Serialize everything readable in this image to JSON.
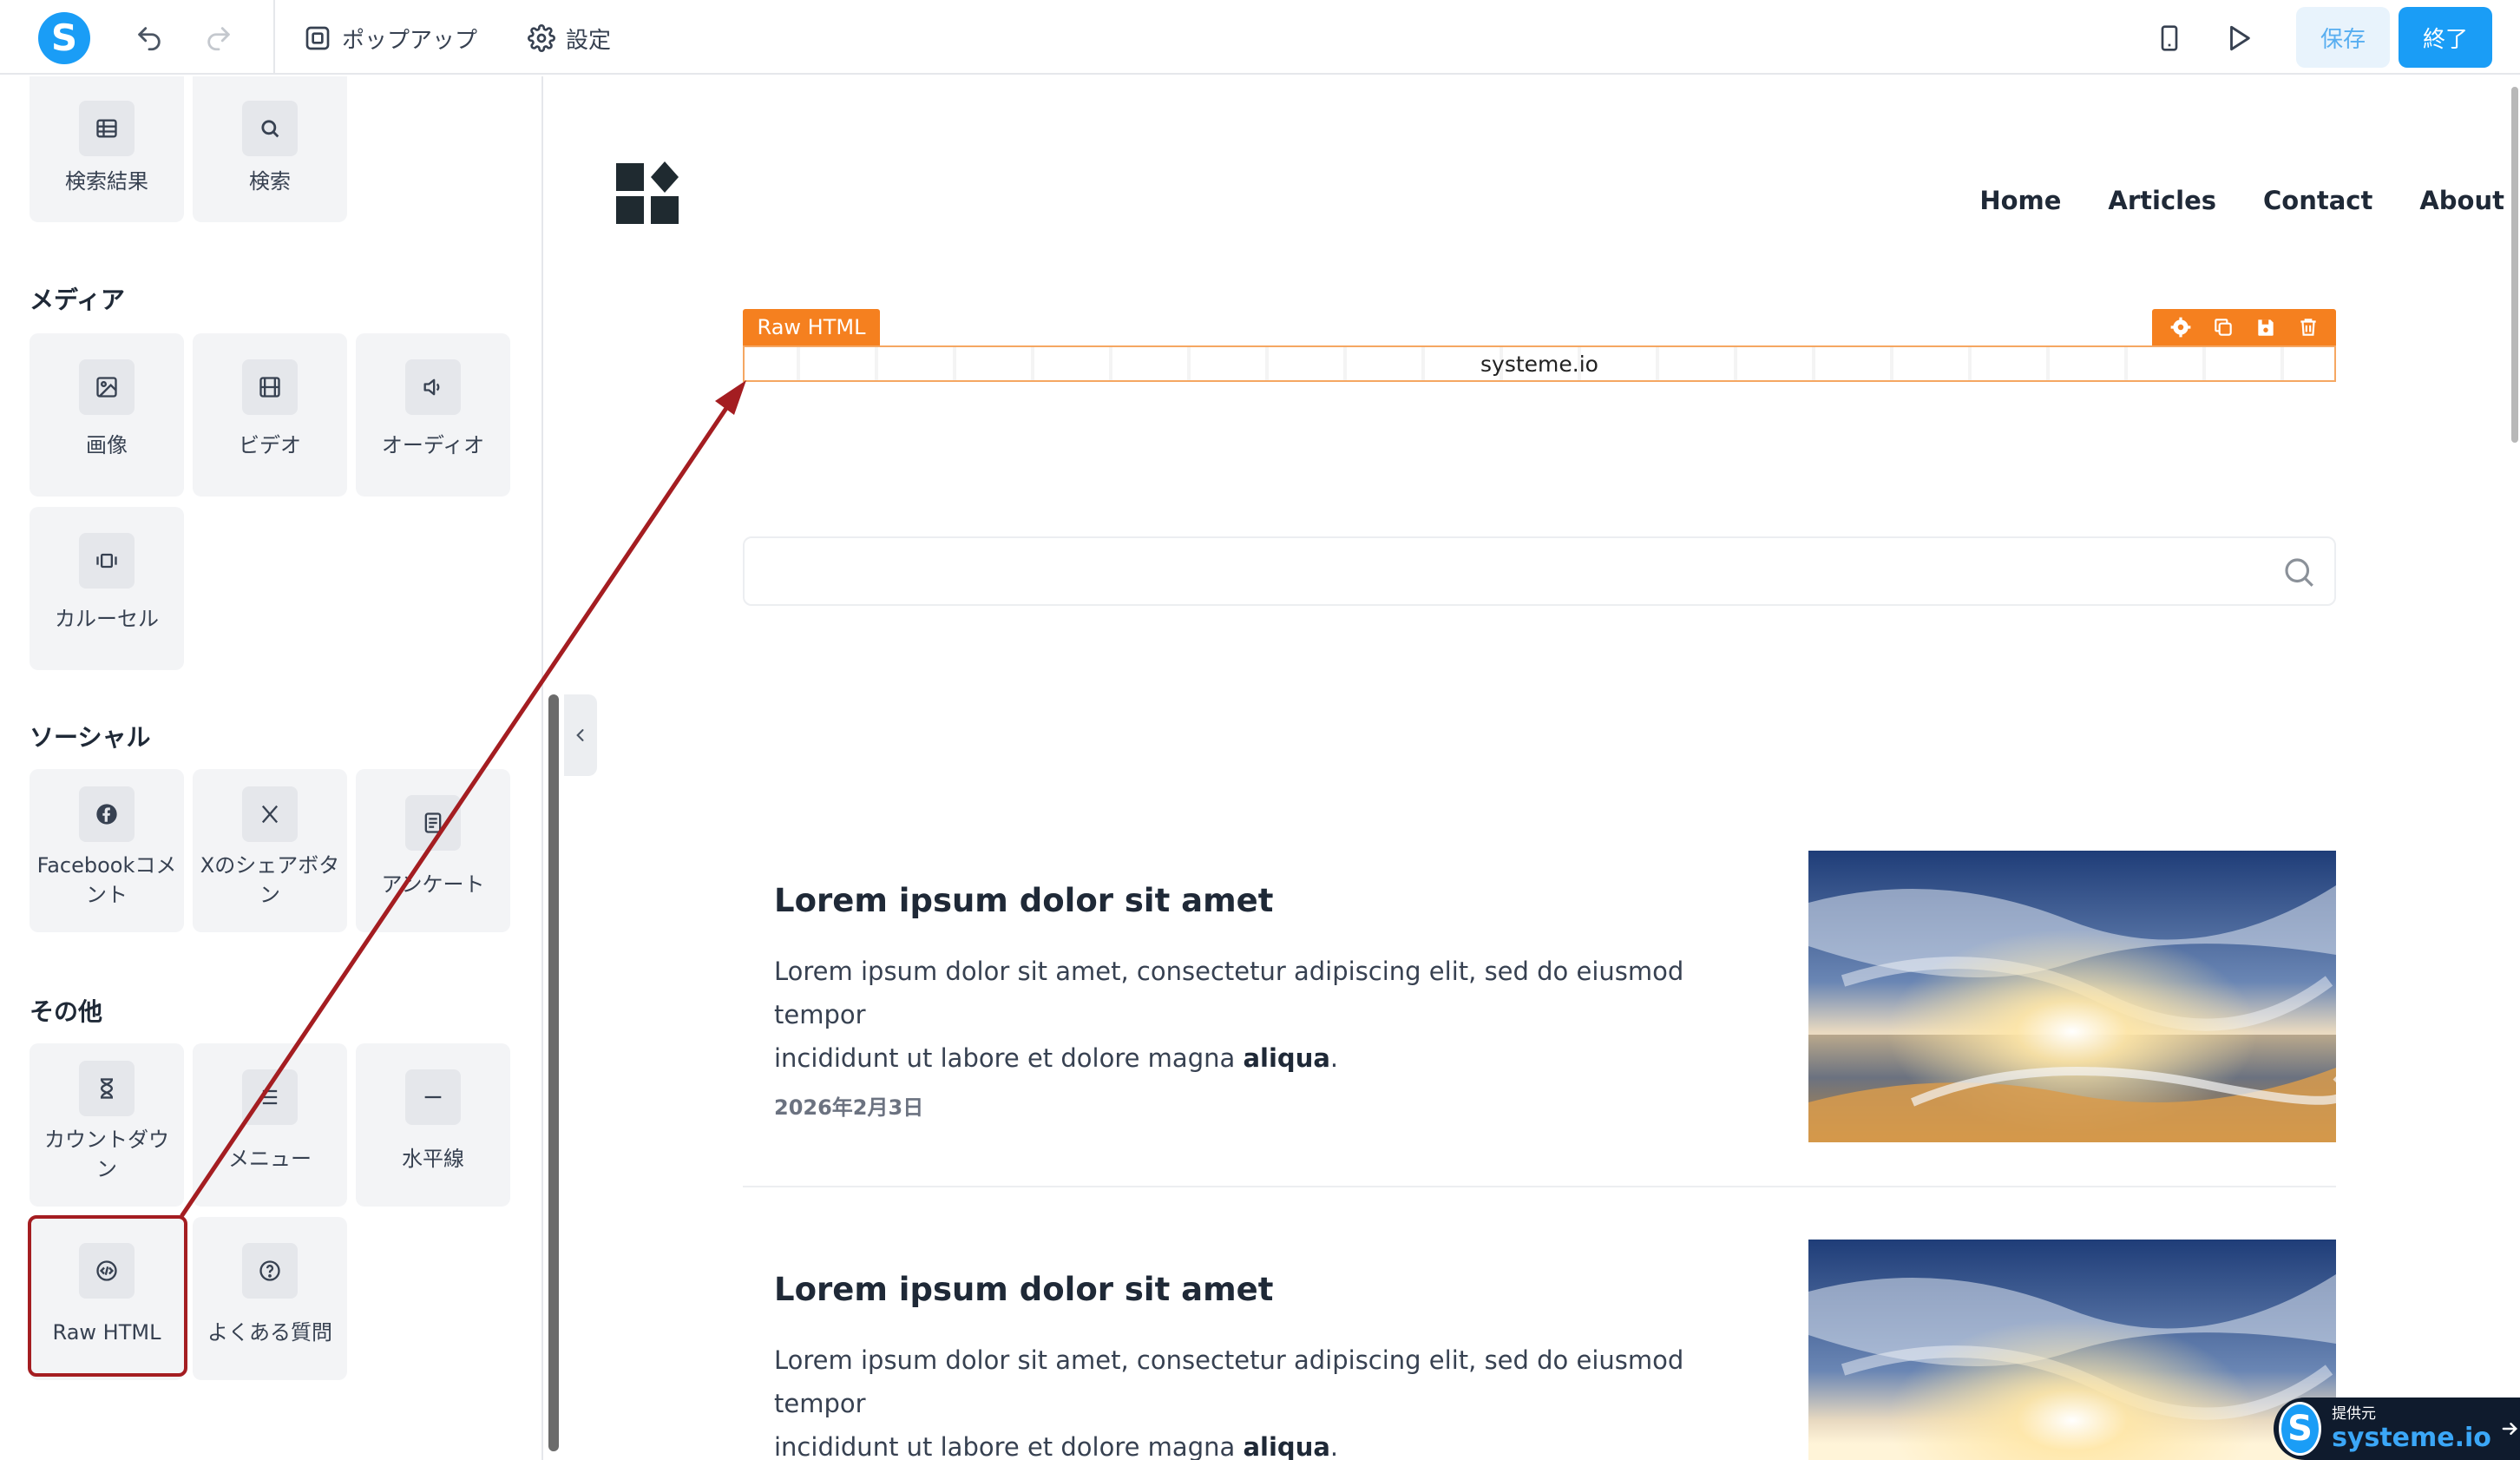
{
  "toolbar": {
    "logo_letter": "S",
    "popup_label": "ポップアップ",
    "settings_label": "設定",
    "save_label": "保存",
    "finish_label": "終了"
  },
  "sidebar": {
    "top_items": [
      {
        "label": "検索結果",
        "icon": "table-icon"
      },
      {
        "label": "検索",
        "icon": "search-icon"
      }
    ],
    "sections": {
      "media": {
        "title": "メディア",
        "items": [
          {
            "label": "画像",
            "icon": "image-icon"
          },
          {
            "label": "ビデオ",
            "icon": "video-icon"
          },
          {
            "label": "オーディオ",
            "icon": "audio-icon"
          },
          {
            "label": "カルーセル",
            "icon": "carousel-icon"
          }
        ]
      },
      "social": {
        "title": "ソーシャル",
        "items": [
          {
            "label": "Facebookコメント",
            "icon": "facebook-icon"
          },
          {
            "label": "Xのシェアボタン",
            "icon": "x-icon"
          },
          {
            "label": "アンケート",
            "icon": "survey-icon"
          }
        ]
      },
      "other": {
        "title": "その他",
        "items": [
          {
            "label": "カウントダウン",
            "icon": "hourglass-icon"
          },
          {
            "label": "メニュー",
            "icon": "menu-icon"
          },
          {
            "label": "水平線",
            "icon": "divider-icon"
          },
          {
            "label": "Raw HTML",
            "icon": "code-icon"
          },
          {
            "label": "よくある質問",
            "icon": "question-icon"
          }
        ]
      }
    }
  },
  "canvas": {
    "nav": [
      "Home",
      "Articles",
      "Contact",
      "About"
    ],
    "raw_html_tag": "Raw HTML",
    "raw_html_content": "systeme.io",
    "articles": [
      {
        "title": "Lorem ipsum dolor sit amet",
        "body_line1": "Lorem ipsum dolor sit amet, consectetur adipiscing elit, sed do eiusmod tempor",
        "body_line2": "incididunt ut labore et dolore magna ",
        "body_bold": "aliqua",
        "body_end": ".",
        "date": "2026年2月3日"
      },
      {
        "title": "Lorem ipsum dolor sit amet",
        "body_line1": "Lorem ipsum dolor sit amet, consectetur adipiscing elit, sed do eiusmod tempor",
        "body_line2": "incididunt ut labore et dolore magna ",
        "body_bold": "aliqua",
        "body_end": "."
      }
    ]
  },
  "badge": {
    "small": "提供元",
    "brand": "systeme.io",
    "letter": "S"
  },
  "colors": {
    "brand_blue": "#1a9df6",
    "raw_orange": "#f5801f",
    "highlight_red": "#a41d21"
  }
}
